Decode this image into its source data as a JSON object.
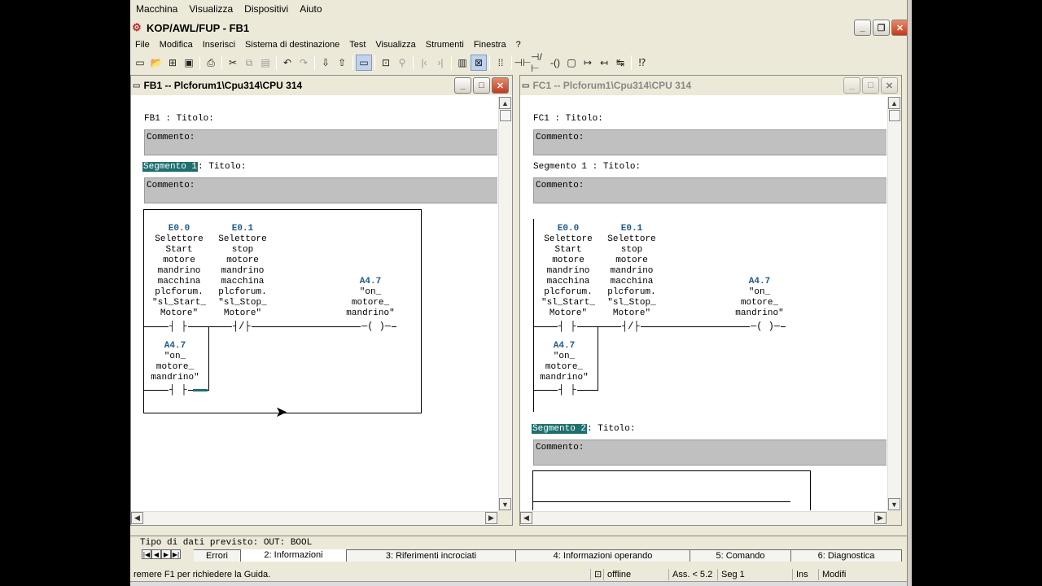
{
  "outer_menu": [
    "Macchina",
    "Visualizza",
    "Dispositivi",
    "Aiuto"
  ],
  "window_title": "KOP/AWL/FUP  - FB1",
  "menu": [
    "File",
    "Modifica",
    "Inserisci",
    "Sistema di destinazione",
    "Test",
    "Visualizza",
    "Strumenti",
    "Finestra",
    "?"
  ],
  "toolbar_icons": [
    "new-icon",
    "open-icon",
    "accessible-nodes-icon",
    "save-icon",
    "print-icon",
    "cut-icon",
    "copy-icon",
    "paste-icon",
    "undo-icon",
    "redo-icon",
    "download-icon",
    "upload-icon",
    "program-elements-icon",
    "network-icon",
    "project-icon",
    "details-icon",
    "overview-icon",
    "comment-icon",
    "no-contact-icon",
    "nc-contact-icon",
    "coil-icon",
    "box-icon",
    "branch-open-icon",
    "branch-close-icon",
    "help-icon"
  ],
  "win_fb1": {
    "title": "FB1 -- Plcforum1\\Cpu314\\CPU 314",
    "block_title": "FB1 : Titolo:",
    "comment_label": "Commento:",
    "segment_label": "Segmento 1",
    "segment_title": ": Titolo:",
    "segment_comment": "Commento:",
    "c1": {
      "addr": "E0.0",
      "text": "Selettore\nStart\nmotore\nmandrino\nmacchina\nplcforum.\n\"sl_Start_\nMotore\""
    },
    "c2": {
      "addr": "E0.1",
      "text": "Selettore\nstop\nmotore\nmandrino\nmacchina\nplcforum.\n\"sl_Stop_\nMotore\""
    },
    "coil": {
      "addr": "A4.7",
      "text": "\"on_\nmotore_\nmandrino\""
    },
    "c3": {
      "addr": "A4.7",
      "text": "\"on_\nmotore_\nmandrino\""
    }
  },
  "win_fc1": {
    "title": "FC1 -- Plcforum1\\Cpu314\\CPU 314",
    "block_title": "FC1 : Titolo:",
    "comment_label": "Commento:",
    "segment_label": "Segmento 1",
    "segment_title": ": Titolo:",
    "segment_comment": "Commento:",
    "segment2_label": "Segmento 2",
    "segment2_title": ": Titolo:",
    "segment2_comment": "Commento:",
    "c1": {
      "addr": "E0.0",
      "text": "Selettore\nStart\nmotore\nmandrino\nmacchina\nplcforum.\n\"sl_Start_\nMotore\""
    },
    "c2": {
      "addr": "E0.1",
      "text": "Selettore\nstop\nmotore\nmandrino\nmacchina\nplcforum.\n\"sl_Stop_\nMotore\""
    },
    "coil": {
      "addr": "A4.7",
      "text": "\"on_\nmotore_\nmandrino\""
    },
    "c3": {
      "addr": "A4.7",
      "text": "\"on_\nmotore_\nmandrino\""
    }
  },
  "info_text": "Tipo di dati previsto: OUT: BOOL",
  "tabs": [
    "Errori",
    "2: Informazioni",
    "3: Riferimenti incrociati",
    "4: Informazioni operando",
    "5: Comando",
    "6: Diagnostica"
  ],
  "active_tab": "2: Informazioni",
  "status": {
    "help": "remere F1 per richiedere la Guida.",
    "online": "offline",
    "abs": "Ass. < 5.2",
    "seg": "Seg 1",
    "ins": "Ins",
    "modified": "Modifi"
  }
}
